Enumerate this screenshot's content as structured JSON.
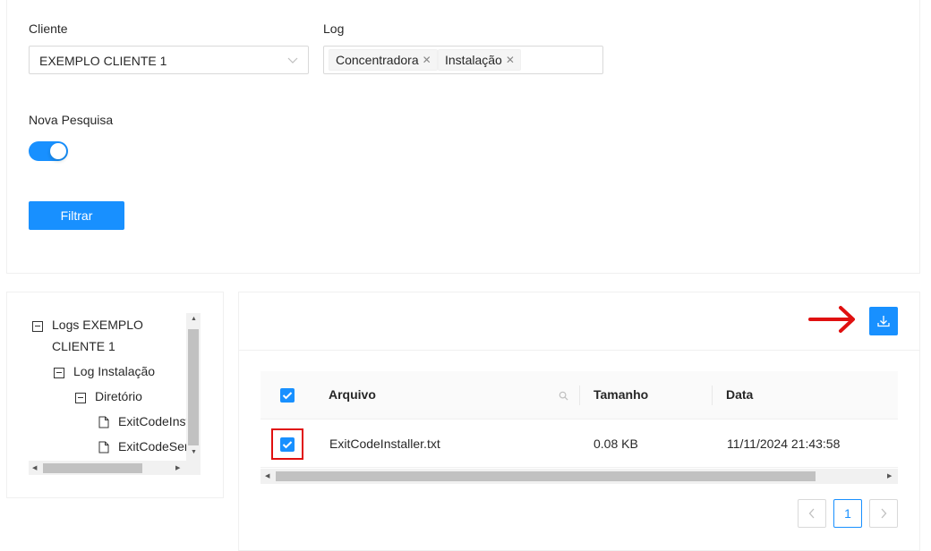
{
  "filters": {
    "cliente_label": "Cliente",
    "cliente_value": "EXEMPLO CLIENTE 1",
    "log_label": "Log",
    "log_tags": [
      "Concentradora",
      "Instalação"
    ],
    "nova_pesquisa_label": "Nova Pesquisa",
    "nova_pesquisa_on": true,
    "filtrar_label": "Filtrar"
  },
  "tree": {
    "root_line1": "Logs EXEMPLO",
    "root_line2": "CLIENTE 1",
    "log_instalacao": "Log Instalação",
    "diretorio": "Diretório",
    "file1": "ExitCodeInst",
    "file2": "ExitCodeSen"
  },
  "table": {
    "columns": [
      "Arquivo",
      "Tamanho",
      "Data"
    ],
    "rows": [
      {
        "arquivo": "ExitCodeInstaller.txt",
        "tamanho": "0.08 KB",
        "data": "11/11/2024 21:43:58",
        "checked": true
      }
    ]
  },
  "pagination": {
    "current": "1"
  },
  "colors": {
    "primary": "#1890ff",
    "annotation": "#e01010"
  }
}
